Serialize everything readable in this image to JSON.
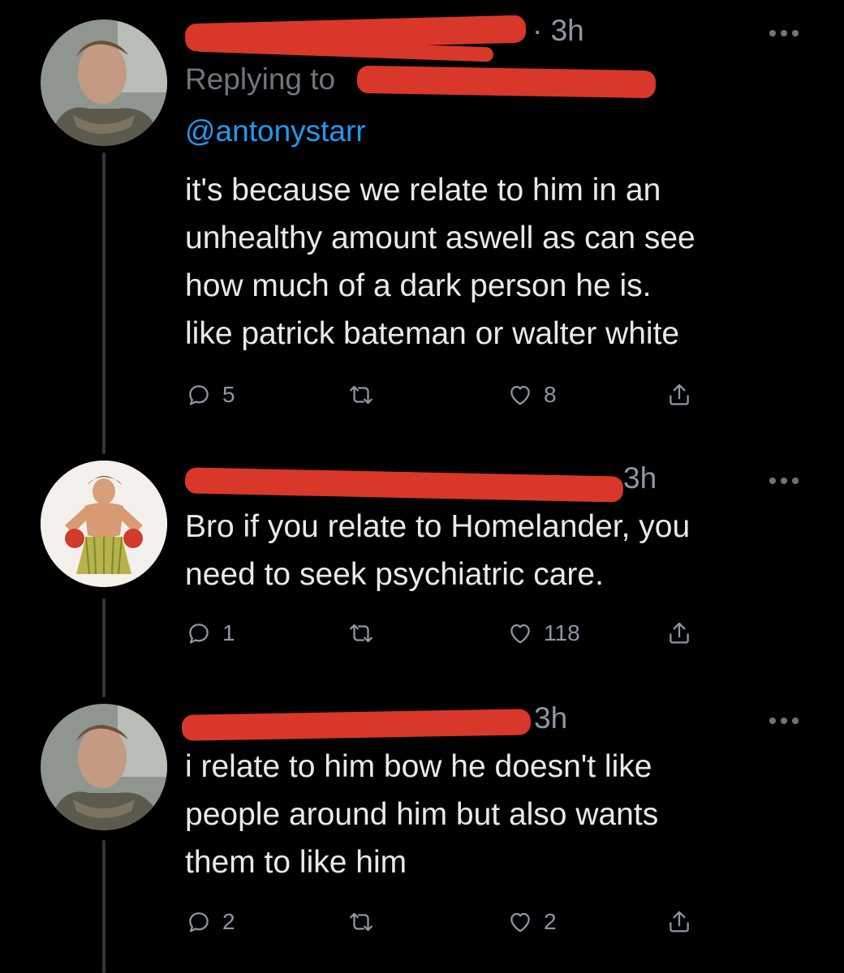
{
  "colors": {
    "background": "#000000",
    "text": "#e7e9ea",
    "muted": "#8b98a5",
    "link": "#1d9bf0",
    "redaction": "#d8372a"
  },
  "tweets": [
    {
      "time": "· 3h",
      "replying_to_prefix": "Replying to",
      "mention": "@antonystarr",
      "text": "it's because we relate to him in an\nunhealthy amount aswell as can see\nhow much of a dark person he is.\nlike patrick bateman or walter white",
      "replies": "5",
      "retweets": "",
      "likes": "8",
      "icons": [
        "reply-icon",
        "retweet-icon",
        "like-icon",
        "share-icon"
      ]
    },
    {
      "time": "3h",
      "text": "Bro if you relate to Homelander, you\nneed to seek psychiatric care.",
      "replies": "1",
      "retweets": "",
      "likes": "118",
      "icons": [
        "reply-icon",
        "retweet-icon",
        "like-icon",
        "share-icon"
      ]
    },
    {
      "time": "3h",
      "text": "i relate to him bow he doesn't like\npeople around him but also wants\nthem to like him",
      "replies": "2",
      "retweets": "",
      "likes": "2",
      "icons": [
        "reply-icon",
        "retweet-icon",
        "like-icon",
        "share-icon"
      ]
    }
  ]
}
